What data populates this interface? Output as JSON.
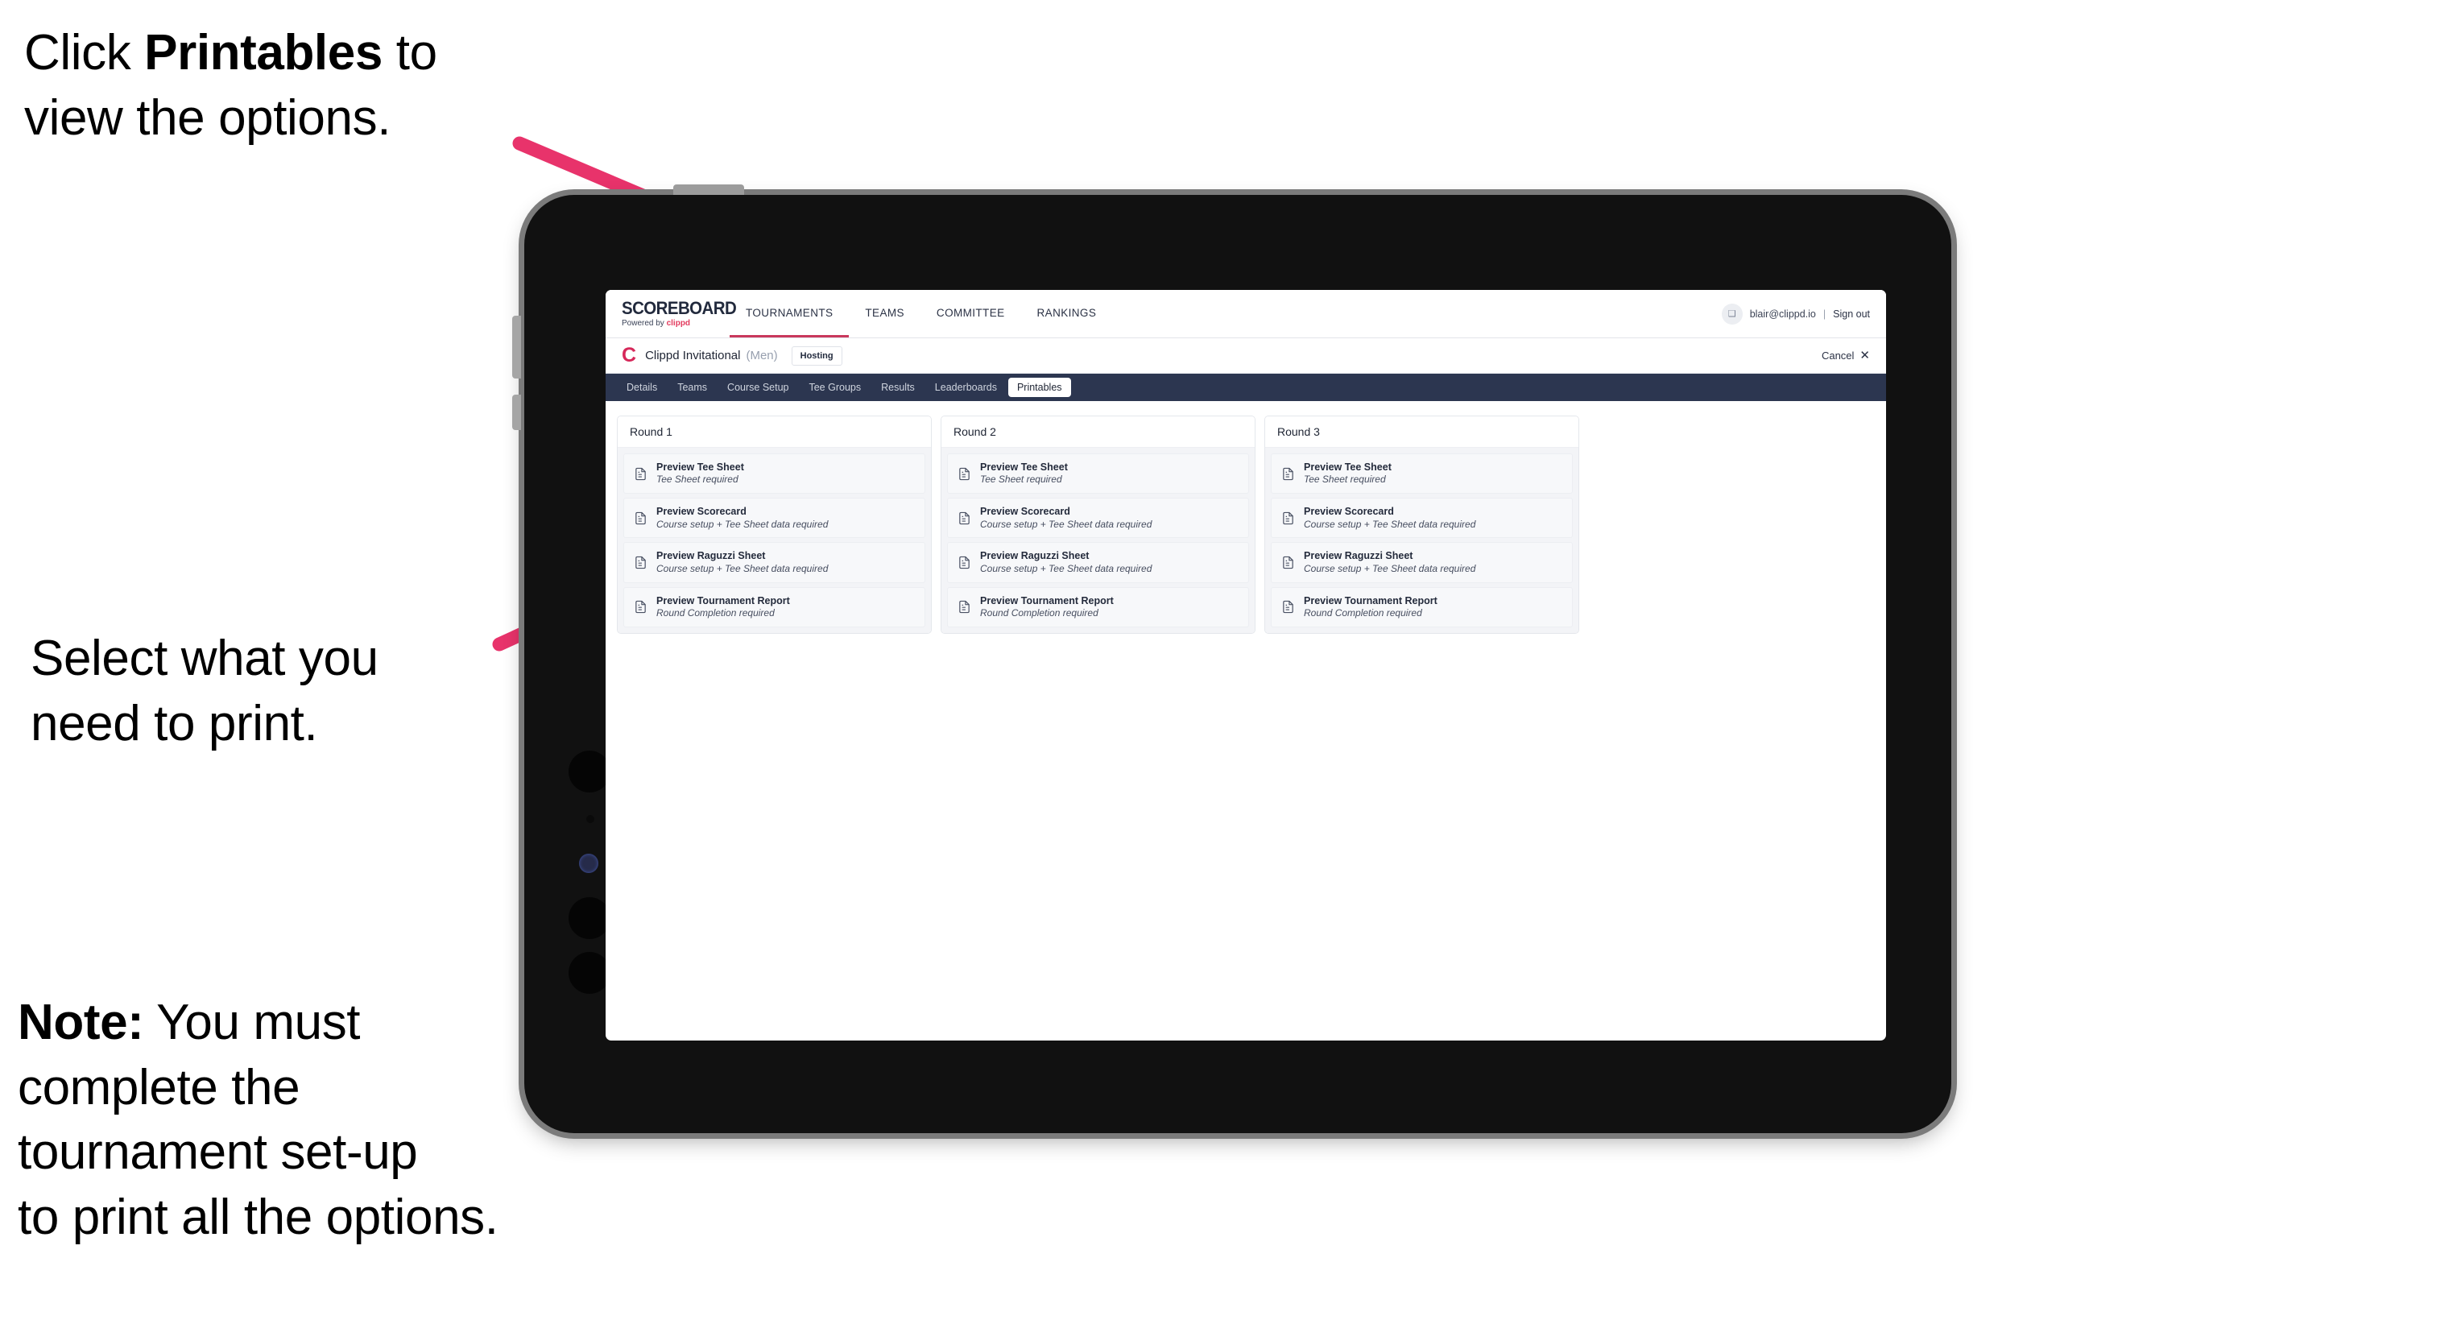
{
  "annotations": [
    {
      "id": "a1",
      "pre": "Click ",
      "strong": "Printables",
      "post": " to\nview the options."
    },
    {
      "id": "a2",
      "pre": "Select what you\n need to print.",
      "strong": "",
      "post": ""
    },
    {
      "id": "a3",
      "pre": "",
      "strong": "Note:",
      "post": " You must\ncomplete the\ntournament set-up\nto print all the options."
    }
  ],
  "colors": {
    "arrow_pink": "#E8336B",
    "tab_bar_navy": "#2C3650",
    "brand_red": "#D6285A",
    "accent_underline": "#C9385C"
  },
  "topbar": {
    "brand_title": "SCOREBOARD",
    "brand_sub_prefix": "Powered by ",
    "brand_sub_name": "clippd",
    "nav": [
      {
        "label": "TOURNAMENTS",
        "active": true
      },
      {
        "label": "TEAMS",
        "active": false
      },
      {
        "label": "COMMITTEE",
        "active": false
      },
      {
        "label": "RANKINGS",
        "active": false
      }
    ],
    "avatar_glyph": "❑",
    "user_email": "blair@clippd.io",
    "separator": "|",
    "sign_out": "Sign out"
  },
  "tournament_bar": {
    "logo_glyph": "C",
    "name": "Clippd Invitational",
    "gender": "(Men)",
    "badge": "Hosting",
    "cancel_label": "Cancel",
    "cancel_icon": "✕"
  },
  "tabs": [
    {
      "label": "Details",
      "active": false
    },
    {
      "label": "Teams",
      "active": false
    },
    {
      "label": "Course Setup",
      "active": false
    },
    {
      "label": "Tee Groups",
      "active": false
    },
    {
      "label": "Results",
      "active": false
    },
    {
      "label": "Leaderboards",
      "active": false
    },
    {
      "label": "Printables",
      "active": true
    }
  ],
  "rounds": [
    {
      "title": "Round 1",
      "items": [
        {
          "title": "Preview Tee Sheet",
          "sub": "Tee Sheet required"
        },
        {
          "title": "Preview Scorecard",
          "sub": "Course setup + Tee Sheet data required"
        },
        {
          "title": "Preview Raguzzi Sheet",
          "sub": "Course setup + Tee Sheet data required"
        },
        {
          "title": "Preview Tournament Report",
          "sub": "Round Completion required"
        }
      ]
    },
    {
      "title": "Round 2",
      "items": [
        {
          "title": "Preview Tee Sheet",
          "sub": "Tee Sheet required"
        },
        {
          "title": "Preview Scorecard",
          "sub": "Course setup + Tee Sheet data required"
        },
        {
          "title": "Preview Raguzzi Sheet",
          "sub": "Course setup + Tee Sheet data required"
        },
        {
          "title": "Preview Tournament Report",
          "sub": "Round Completion required"
        }
      ]
    },
    {
      "title": "Round 3",
      "items": [
        {
          "title": "Preview Tee Sheet",
          "sub": "Tee Sheet required"
        },
        {
          "title": "Preview Scorecard",
          "sub": "Course setup + Tee Sheet data required"
        },
        {
          "title": "Preview Raguzzi Sheet",
          "sub": "Course setup + Tee Sheet data required"
        },
        {
          "title": "Preview Tournament Report",
          "sub": "Round Completion required"
        }
      ]
    }
  ]
}
